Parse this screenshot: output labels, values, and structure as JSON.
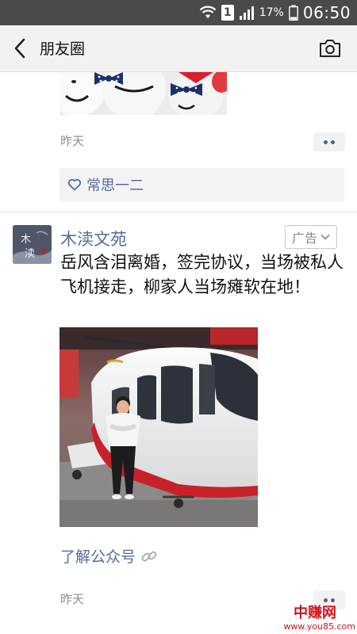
{
  "status_bar": {
    "sim_slot": "1",
    "battery_percent": "17%",
    "time": "06:50",
    "icons": [
      "wifi-icon",
      "signal-icon",
      "battery-icon"
    ]
  },
  "nav": {
    "title": "朋友圈",
    "back_icon": "back-arrow-icon",
    "camera_icon": "camera-icon"
  },
  "previous_post": {
    "time": "昨天",
    "liked_by": "常思一二"
  },
  "ad_post": {
    "account_name": "木渎文苑",
    "avatar_text": "木渎",
    "ad_label": "广告",
    "text": "岳风含泪离婚，签完协议，当场被私人飞机接走，柳家人当场瘫软在地！",
    "link_text": "了解公众号",
    "time": "昨天"
  },
  "watermark": {
    "title": "中赚网",
    "url": "www.you85.com"
  },
  "colors": {
    "link_blue": "#576b95",
    "status_bar": "#4a4a4a",
    "nav_bar": "#f2f2f2",
    "watermark_red": "#d0121b"
  }
}
